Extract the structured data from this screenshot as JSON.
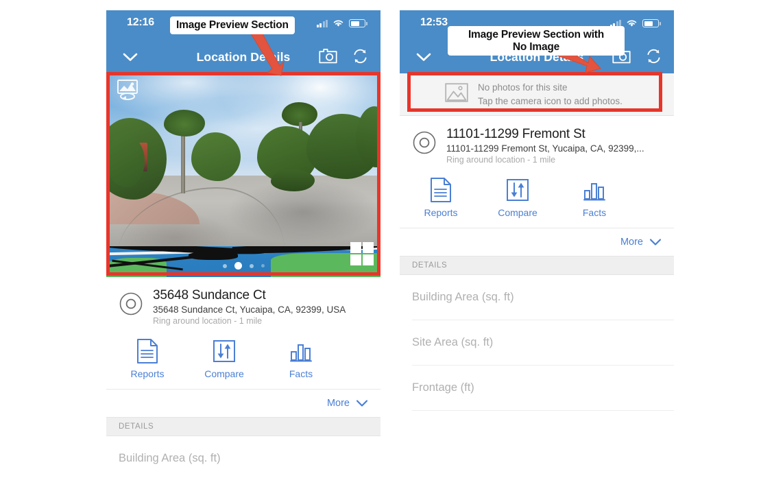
{
  "annotations": [
    {
      "id": "left",
      "label": "Image Preview Section",
      "arrow_name": "annotation-arrow-left"
    },
    {
      "id": "right",
      "label": "Image Preview Section with\nNo Image",
      "arrow_name": "annotation-arrow-right"
    }
  ],
  "colors": {
    "header_blue": "#4a8cc7",
    "annotation_red": "#e8352a",
    "action_blue": "#4a7fd4",
    "muted_gray": "#b0b0b0"
  },
  "left_phone": {
    "status": {
      "time": "12:16",
      "location_icon": "location-arrow-icon",
      "signal_icon": "cellular-signal-icon",
      "wifi_icon": "wifi-icon",
      "battery_icon": "battery-icon"
    },
    "nav": {
      "back_icon": "chevron-down-icon",
      "title": "Location Details",
      "camera_icon": "camera-icon",
      "refresh_icon": "refresh-icon"
    },
    "preview": {
      "has_image": true,
      "panorama_badge_icon": "panorama-360-icon",
      "grid_icon": "grid-view-icon",
      "dot_count": 4,
      "active_dot_index": 1
    },
    "location": {
      "pin_icon": "ring-location-icon",
      "title": "35648 Sundance Ct",
      "address": "35648 Sundance Ct, Yucaipa, CA, 92399, USA",
      "ring": "Ring around location - 1 mile"
    },
    "actions": [
      {
        "label": "Reports",
        "icon": "document-icon"
      },
      {
        "label": "Compare",
        "icon": "compare-arrows-icon"
      },
      {
        "label": "Facts",
        "icon": "bar-chart-icon"
      }
    ],
    "more": {
      "label": "More",
      "icon": "chevron-down-icon"
    },
    "details_header": "DETAILS",
    "details_rows": [
      "Building Area (sq. ft)"
    ]
  },
  "right_phone": {
    "status": {
      "time": "12:53",
      "location_icon": "location-arrow-icon",
      "signal_icon": "cellular-signal-icon",
      "wifi_icon": "wifi-icon",
      "battery_icon": "battery-icon"
    },
    "nav": {
      "back_icon": "chevron-down-icon",
      "title": "Location Details",
      "camera_icon": "camera-icon",
      "refresh_icon": "refresh-icon"
    },
    "preview": {
      "has_image": false,
      "placeholder_icon": "image-placeholder-icon",
      "line1": "No photos for this site",
      "line2": "Tap the camera icon to add photos."
    },
    "location": {
      "pin_icon": "ring-location-icon",
      "title": "11101-11299 Fremont St",
      "address": "11101-11299 Fremont St, Yucaipa, CA, 92399,...",
      "ring": "Ring around location - 1 mile"
    },
    "actions": [
      {
        "label": "Reports",
        "icon": "document-icon"
      },
      {
        "label": "Compare",
        "icon": "compare-arrows-icon"
      },
      {
        "label": "Facts",
        "icon": "bar-chart-icon"
      }
    ],
    "more": {
      "label": "More",
      "icon": "chevron-down-icon"
    },
    "details_header": "DETAILS",
    "details_rows": [
      "Building Area (sq. ft)",
      "Site Area (sq. ft)",
      "Frontage (ft)"
    ]
  }
}
